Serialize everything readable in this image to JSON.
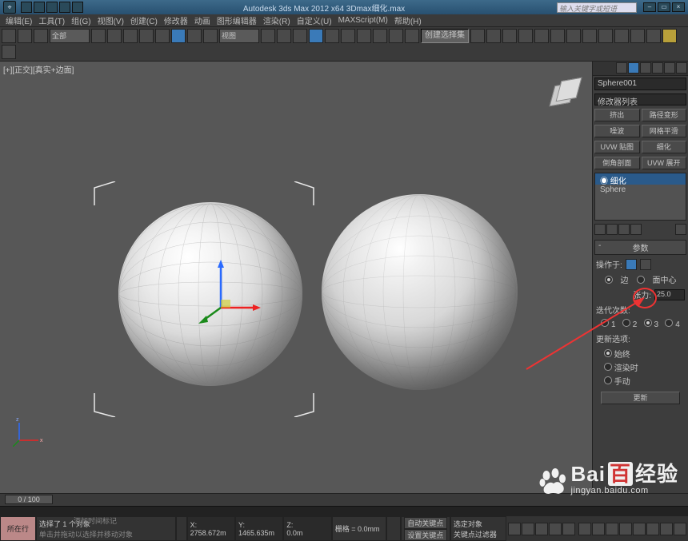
{
  "title": "Autodesk 3ds Max 2012 x64   3Dmax细化.max",
  "search_ph": "输入关键字或短语",
  "menus": [
    "编辑(E)",
    "工具(T)",
    "组(G)",
    "视图(V)",
    "创建(C)",
    "修改器",
    "动画",
    "图形编辑器",
    "渲染(R)",
    "自定义(U)",
    "MAXScript(M)",
    "帮助(H)"
  ],
  "toolbar": {
    "selset_label": "创建选择集",
    "pick_label": "全部",
    "view_label": "视图"
  },
  "viewport_label": "[+][正交][真实+边面]",
  "panel": {
    "object": "Sphere001",
    "list": "修改器列表",
    "buttons": [
      [
        "挤出",
        "路径变形"
      ],
      [
        "噪波",
        "网格平滑"
      ],
      [
        "UVW 贴图",
        "细化"
      ],
      [
        "倒角剖面",
        "UVW 展开"
      ]
    ],
    "stack": [
      "◉ 细化",
      "Sphere"
    ],
    "rollout": "参数",
    "operate_label": "操作于:",
    "edge": "边",
    "facectr": "面中心",
    "tension_label": "张力:",
    "tension": "25.0",
    "iter_label": "迭代次数:",
    "iters": [
      "1",
      "2",
      "3",
      "4"
    ],
    "iter_sel": 2,
    "update_label": "更新选项:",
    "updates": [
      "始终",
      "渲染时",
      "手动"
    ],
    "update_sel": 0,
    "update_btn": "更新"
  },
  "timeline": {
    "slider": "0 / 100"
  },
  "status": {
    "tab": "所在行",
    "sel": "选择了 1 个对象",
    "hint": "单击并拖动以选择并移动对象",
    "x": "2758.672m",
    "y": "1465.635m",
    "z": "0.0m",
    "grid": "栅格 = 0.0mm",
    "autokey": "自动关键点",
    "selfilter": "选定对象",
    "setkey": "设置关键点",
    "keyfilter": "关键点过滤器",
    "addtime": "添加时间标记"
  },
  "watermark": {
    "brand": "Bai",
    "du": "百",
    "cn": "经验",
    "url": "jingyan.baidu.com"
  }
}
